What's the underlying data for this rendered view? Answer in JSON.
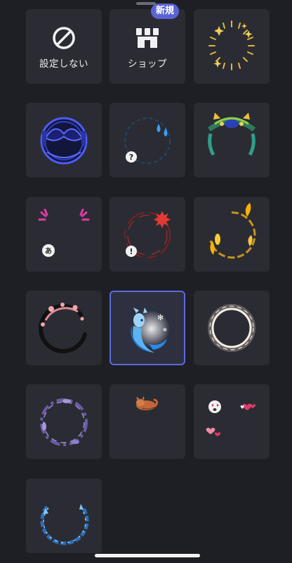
{
  "header": {
    "new_badge": "新規"
  },
  "tiles": [
    {
      "label": "設定しない",
      "icon": "no-entry-icon"
    },
    {
      "label": "ショップ",
      "icon": "shop-icon"
    },
    {
      "icon": "sparkle-frame-icon"
    },
    {
      "icon": "blue-helmet-frame-icon"
    },
    {
      "icon": "sweat-drops-frame-icon"
    },
    {
      "icon": "green-dragon-frame-icon"
    },
    {
      "icon": "pink-surprise-frame-icon"
    },
    {
      "icon": "red-anger-frame-icon"
    },
    {
      "icon": "gold-flame-frame-icon"
    },
    {
      "icon": "sakura-branch-frame-icon"
    },
    {
      "icon": "blue-dragon-moon-frame-icon",
      "selected": true
    },
    {
      "icon": "white-ring-frame-icon"
    },
    {
      "icon": "purple-vine-frame-icon"
    },
    {
      "icon": "sleeping-cat-frame-icon"
    },
    {
      "icon": "hearts-frame-icon"
    },
    {
      "icon": "blue-crystal-frame-icon"
    }
  ],
  "colors": {
    "background": "#1e1f24",
    "tile": "#2b2c33",
    "accent": "#5b63d3"
  }
}
